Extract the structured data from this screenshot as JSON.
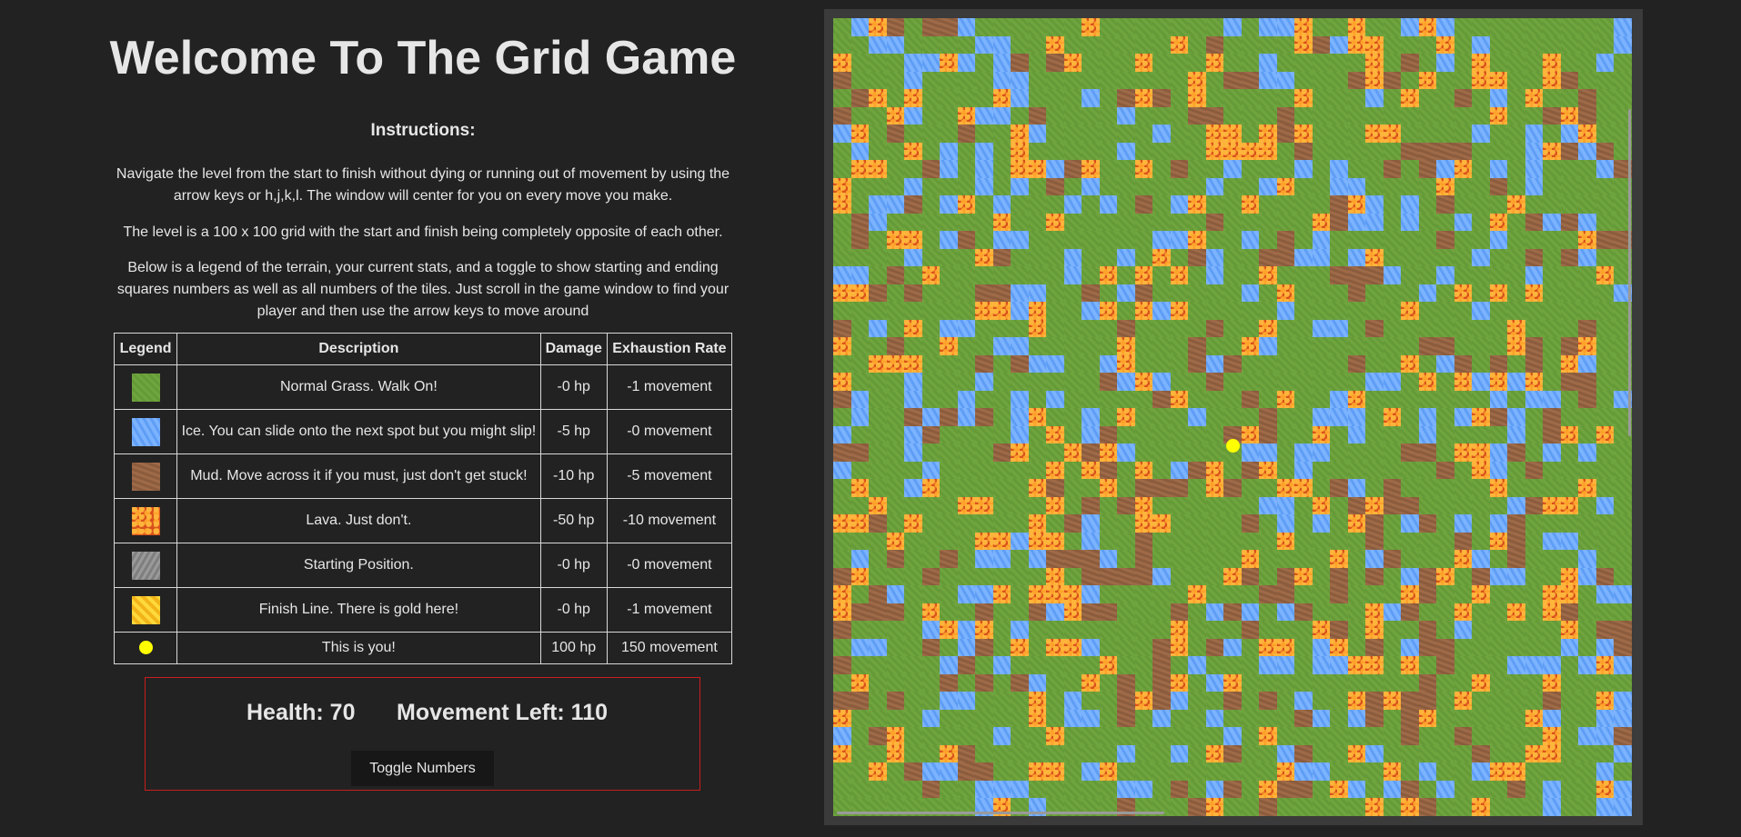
{
  "title": "Welcome To The Grid Game",
  "instructions": {
    "heading": "Instructions:",
    "paragraphs": [
      "Navigate the level from the start to finish without dying or running out of movement by using the arrow keys or h,j,k,l. The window will center for you on every move you make.",
      "The level is a 100 x 100 grid with the start and finish being completely opposite of each other.",
      "Below is a legend of the terrain, your current stats, and a toggle to show starting and ending squares numbers as well as all numbers of the tiles. Just scroll in the game window to find your player and then use the arrow keys to move around"
    ]
  },
  "legend": {
    "headers": [
      "Legend",
      "Description",
      "Damage",
      "Exhaustion Rate"
    ],
    "rows": [
      {
        "icon": "grass-tile-icon",
        "description": "Normal Grass. Walk On!",
        "damage": "-0 hp",
        "exhaustion": "-1 movement"
      },
      {
        "icon": "ice-tile-icon",
        "description": "Ice. You can slide onto the next spot but you might slip!",
        "damage": "-5 hp",
        "exhaustion": "-0 movement"
      },
      {
        "icon": "mud-tile-icon",
        "description": "Mud. Move across it if you must, just don't get stuck!",
        "damage": "-10 hp",
        "exhaustion": "-5 movement"
      },
      {
        "icon": "lava-tile-icon",
        "description": "Lava. Just don't.",
        "damage": "-50 hp",
        "exhaustion": "-10 movement"
      },
      {
        "icon": "start-tile-icon",
        "description": "Starting Position.",
        "damage": "-0 hp",
        "exhaustion": "-0 movement"
      },
      {
        "icon": "finish-tile-icon",
        "description": "Finish Line. There is gold here!",
        "damage": "-0 hp",
        "exhaustion": "-1 movement"
      },
      {
        "icon": "player-icon",
        "description": "This is you!",
        "damage": "100 hp",
        "exhaustion": "150 movement"
      }
    ]
  },
  "stats": {
    "health": "Health: 70",
    "movement": "Movement Left: 110"
  },
  "toggle_label": "Toggle Numbers",
  "colors": {
    "background": "#222222",
    "grass": "#6fa43e",
    "ice": "#7cb3ff",
    "mud": "#9e6a48",
    "lava": "#d8511c",
    "player": "#ffff00",
    "stats_border": "#c81e1e"
  }
}
